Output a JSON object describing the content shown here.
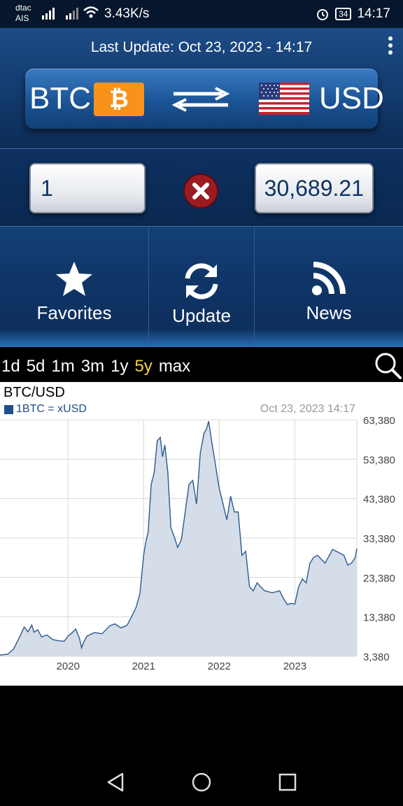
{
  "status_bar": {
    "carrier_line1": "dtac",
    "carrier_line2": "AIS",
    "net_speed": "3.43K/s",
    "battery": "34",
    "time": "14:17"
  },
  "header": {
    "last_update": "Last Update: Oct 23, 2023 - 14:17",
    "from_currency": "BTC",
    "from_symbol": "₿",
    "to_currency": "USD"
  },
  "converter": {
    "amount": "1",
    "result": "30,689.21"
  },
  "nav": {
    "favorites": "Favorites",
    "update": "Update",
    "news": "News"
  },
  "ranges": {
    "items": [
      "1d",
      "5d",
      "1m",
      "3m",
      "1y",
      "5y",
      "max"
    ],
    "selected": "5y"
  },
  "chart_header": {
    "title": "BTC/USD",
    "legend": "1BTC = xUSD",
    "date": "Oct 23, 2023 14:17"
  },
  "colors": {
    "accent": "#f4d43a",
    "header_blue": "#12396b",
    "line": "#2b5a8f",
    "fill": "#d4dde8",
    "btc_orange": "#f7931a"
  },
  "chart_data": {
    "type": "area",
    "title": "BTC/USD",
    "legend": "1BTC = xUSD",
    "x_tick_labels": [
      "2020",
      "2021",
      "2022",
      "2023"
    ],
    "y_tick_labels": [
      "63,380",
      "53,380",
      "43,380",
      "33,380",
      "23,380",
      "13,380",
      "3,380"
    ],
    "ylim": [
      3380,
      63380
    ],
    "xlim": [
      2019.1,
      2023.82
    ],
    "grid": true,
    "series": [
      {
        "name": "1BTC = xUSD",
        "x": [
          2019.1,
          2019.2,
          2019.28,
          2019.35,
          2019.42,
          2019.47,
          2019.52,
          2019.55,
          2019.6,
          2019.65,
          2019.72,
          2019.8,
          2019.88,
          2019.95,
          2020.0,
          2020.05,
          2020.1,
          2020.15,
          2020.18,
          2020.2,
          2020.25,
          2020.35,
          2020.45,
          2020.55,
          2020.62,
          2020.7,
          2020.78,
          2020.85,
          2020.9,
          2020.95,
          2021.0,
          2021.03,
          2021.06,
          2021.1,
          2021.14,
          2021.18,
          2021.22,
          2021.25,
          2021.28,
          2021.32,
          2021.36,
          2021.4,
          2021.45,
          2021.5,
          2021.55,
          2021.6,
          2021.65,
          2021.7,
          2021.75,
          2021.8,
          2021.83,
          2021.86,
          2021.9,
          2021.95,
          2022.0,
          2022.05,
          2022.1,
          2022.15,
          2022.2,
          2022.25,
          2022.3,
          2022.35,
          2022.4,
          2022.45,
          2022.5,
          2022.6,
          2022.7,
          2022.8,
          2022.85,
          2022.9,
          2022.95,
          2023.0,
          2023.05,
          2023.1,
          2023.15,
          2023.2,
          2023.25,
          2023.3,
          2023.4,
          2023.5,
          2023.55,
          2023.6,
          2023.65,
          2023.7,
          2023.75,
          2023.8,
          2023.82
        ],
        "y": [
          3700,
          3900,
          5200,
          7900,
          10800,
          9600,
          11300,
          9500,
          10100,
          8300,
          8800,
          7600,
          7300,
          7200,
          8500,
          9300,
          10300,
          8000,
          5500,
          6700,
          8500,
          9400,
          9100,
          11100,
          11600,
          10600,
          11200,
          13800,
          15800,
          19200,
          29000,
          32500,
          35000,
          47000,
          50000,
          58000,
          58900,
          54000,
          57000,
          50000,
          36000,
          34000,
          31000,
          33000,
          40000,
          47000,
          48000,
          42000,
          55000,
          60000,
          61000,
          63000,
          58000,
          52000,
          46000,
          42000,
          38000,
          44000,
          40000,
          40000,
          29000,
          30000,
          21000,
          20000,
          22000,
          20000,
          19500,
          20000,
          18000,
          16500,
          16800,
          16600,
          21000,
          23000,
          22000,
          27000,
          28500,
          29000,
          27000,
          30500,
          30000,
          29500,
          29000,
          26500,
          27000,
          28500,
          30700
        ]
      }
    ]
  }
}
